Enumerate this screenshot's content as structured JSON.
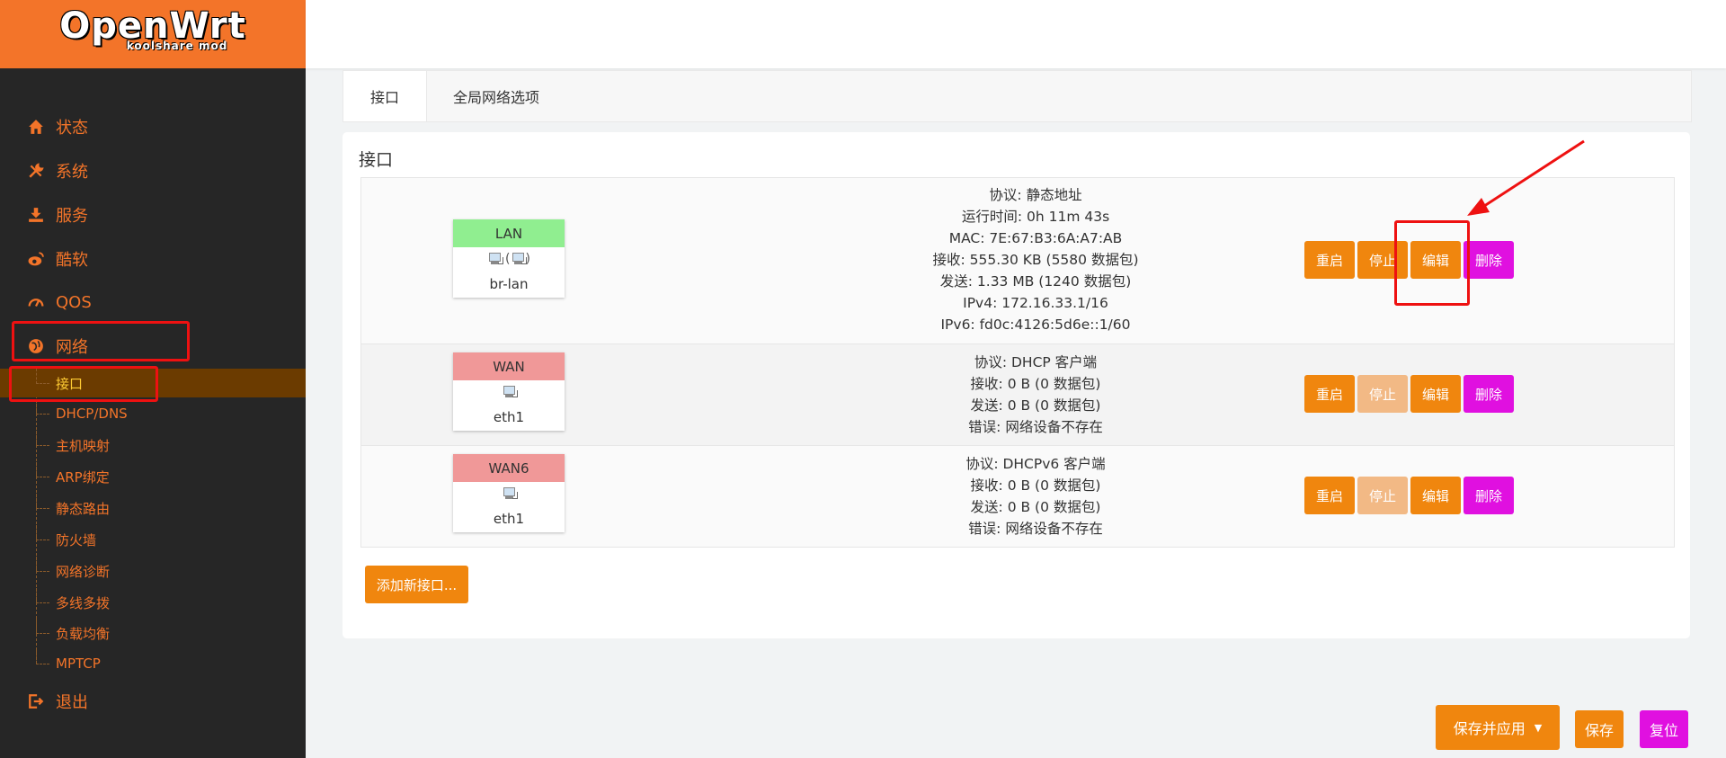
{
  "brand": {
    "name": "OpenWrt",
    "subtitle": "koolshare mod"
  },
  "sidebar": {
    "items": [
      {
        "label": "状态",
        "icon": "home-icon"
      },
      {
        "label": "系统",
        "icon": "tools-icon"
      },
      {
        "label": "服务",
        "icon": "download-icon"
      },
      {
        "label": "酷软",
        "icon": "weibo-icon"
      },
      {
        "label": "QOS",
        "icon": "gauge-icon"
      },
      {
        "label": "网络",
        "icon": "globe-icon"
      },
      {
        "label": "退出",
        "icon": "logout-icon"
      }
    ],
    "network_subitems": [
      "接口",
      "DHCP/DNS",
      "主机映射",
      "ARP绑定",
      "静态路由",
      "防火墙",
      "网络诊断",
      "多线多拨",
      "负载均衡",
      "MPTCP"
    ]
  },
  "tabs": [
    {
      "label": "接口",
      "active": true
    },
    {
      "label": "全局网络选项",
      "active": false
    }
  ],
  "panel": {
    "title": "接口",
    "interfaces": [
      {
        "name": "LAN",
        "header_color": "#90ee90",
        "device": "br-lan",
        "icons": "(",
        "icons_close": ")",
        "info": [
          "协议: 静态地址",
          "运行时间: 0h 11m 43s",
          "MAC: 7E:67:B3:6A:A7:AB",
          "接收: 555.30 KB (5580 数据包)",
          "发送: 1.33 MB (1240 数据包)",
          "IPv4: 172.16.33.1/16",
          "IPv6: fd0c:4126:5d6e::1/60"
        ]
      },
      {
        "name": "WAN",
        "header_color": "#f09898",
        "device": "eth1",
        "info": [
          "协议: DHCP 客户端",
          "接收: 0 B (0 数据包)",
          "发送: 0 B (0 数据包)",
          "错误: 网络设备不存在"
        ]
      },
      {
        "name": "WAN6",
        "header_color": "#f09898",
        "device": "eth1",
        "info": [
          "协议: DHCPv6 客户端",
          "接收: 0 B (0 数据包)",
          "发送: 0 B (0 数据包)",
          "错误: 网络设备不存在"
        ]
      }
    ],
    "actions": {
      "restart": "重启",
      "stop": "停止",
      "edit": "编辑",
      "delete": "删除"
    },
    "add_button": "添加新接口..."
  },
  "footer": {
    "save_apply": "保存并应用",
    "save": "保存",
    "reset": "复位"
  },
  "colors": {
    "accent": "#f37429",
    "button_orange": "#f0860e",
    "button_disabled": "#f2b985",
    "button_magenta": "#e010e0",
    "annotation_red": "#ee1111"
  }
}
